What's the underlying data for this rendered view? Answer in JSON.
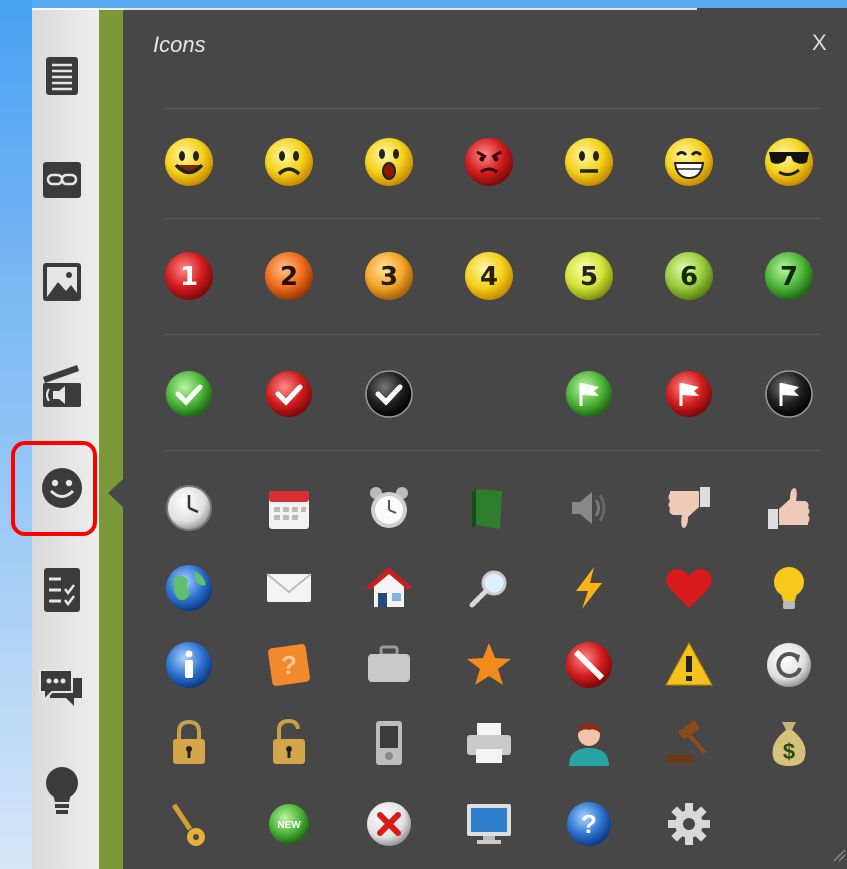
{
  "panel": {
    "title": "Icons",
    "close_label": "X"
  },
  "sidebar": {
    "items": [
      "document-icon",
      "link-icon",
      "image-icon",
      "media-icon",
      "smiley-icon",
      "checklist-icon",
      "chat-icon",
      "lightbulb-icon"
    ],
    "selected": "smiley-icon"
  },
  "icon_rows": [
    [
      "smile",
      "sad",
      "surprised",
      "angry",
      "neutral",
      "grin",
      "cool"
    ],
    [
      "number-1",
      "number-2",
      "number-3",
      "number-4",
      "number-5",
      "number-6",
      "number-7"
    ],
    [
      "check-green",
      "check-red",
      "check-black",
      "",
      "flag-green",
      "flag-red",
      "flag-black"
    ],
    [
      "clock",
      "calendar",
      "alarm-clock",
      "book",
      "speaker",
      "thumbs-down",
      "thumbs-up"
    ],
    [
      "globe",
      "mail",
      "home",
      "magnifier",
      "lightning",
      "heart",
      "bulb"
    ],
    [
      "info",
      "question-box",
      "briefcase",
      "star",
      "no-entry",
      "warning",
      "refresh"
    ],
    [
      "lock",
      "unlock",
      "media-player",
      "printer",
      "user",
      "gavel",
      "money-bag"
    ],
    [
      "key",
      "new-badge",
      "delete",
      "monitor",
      "help",
      "settings",
      ""
    ]
  ],
  "numbers": [
    "1",
    "2",
    "3",
    "4",
    "5",
    "6",
    "7"
  ],
  "new_label": "NEW",
  "colors": {
    "panel": "#474747",
    "accent_green": "#7a9a3a",
    "selection": "#ff0000"
  }
}
